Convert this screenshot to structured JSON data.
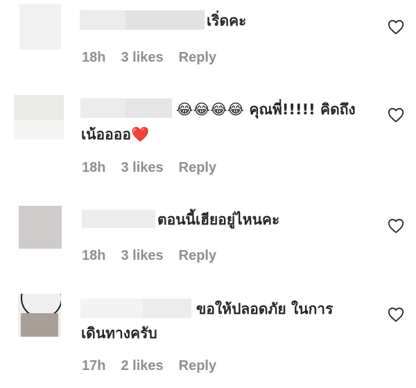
{
  "comments": [
    {
      "text": "เริ่ดคะ",
      "time": "18h",
      "likes": "3 likes",
      "reply": "Reply"
    },
    {
      "text": "😂😂😂😂 คุณพี่!!!!! คิดถึง",
      "text_line2": "เน้ออออ❤️",
      "time": "18h",
      "likes": "3 likes",
      "reply": "Reply"
    },
    {
      "text": "ตอนนี้เฮียอยู่ไหนคะ",
      "time": "18h",
      "likes": "3 likes",
      "reply": "Reply"
    },
    {
      "text": "ขอให้ปลอดภัย ในการ",
      "text_line2": "เดินทางครับ",
      "time": "17h",
      "likes": "2 likes",
      "reply": "Reply"
    }
  ],
  "colors": {
    "text": "#262626",
    "meta": "#8e8e8e",
    "background": "#ffffff"
  },
  "icons": {
    "like": "heart-outline-icon"
  }
}
